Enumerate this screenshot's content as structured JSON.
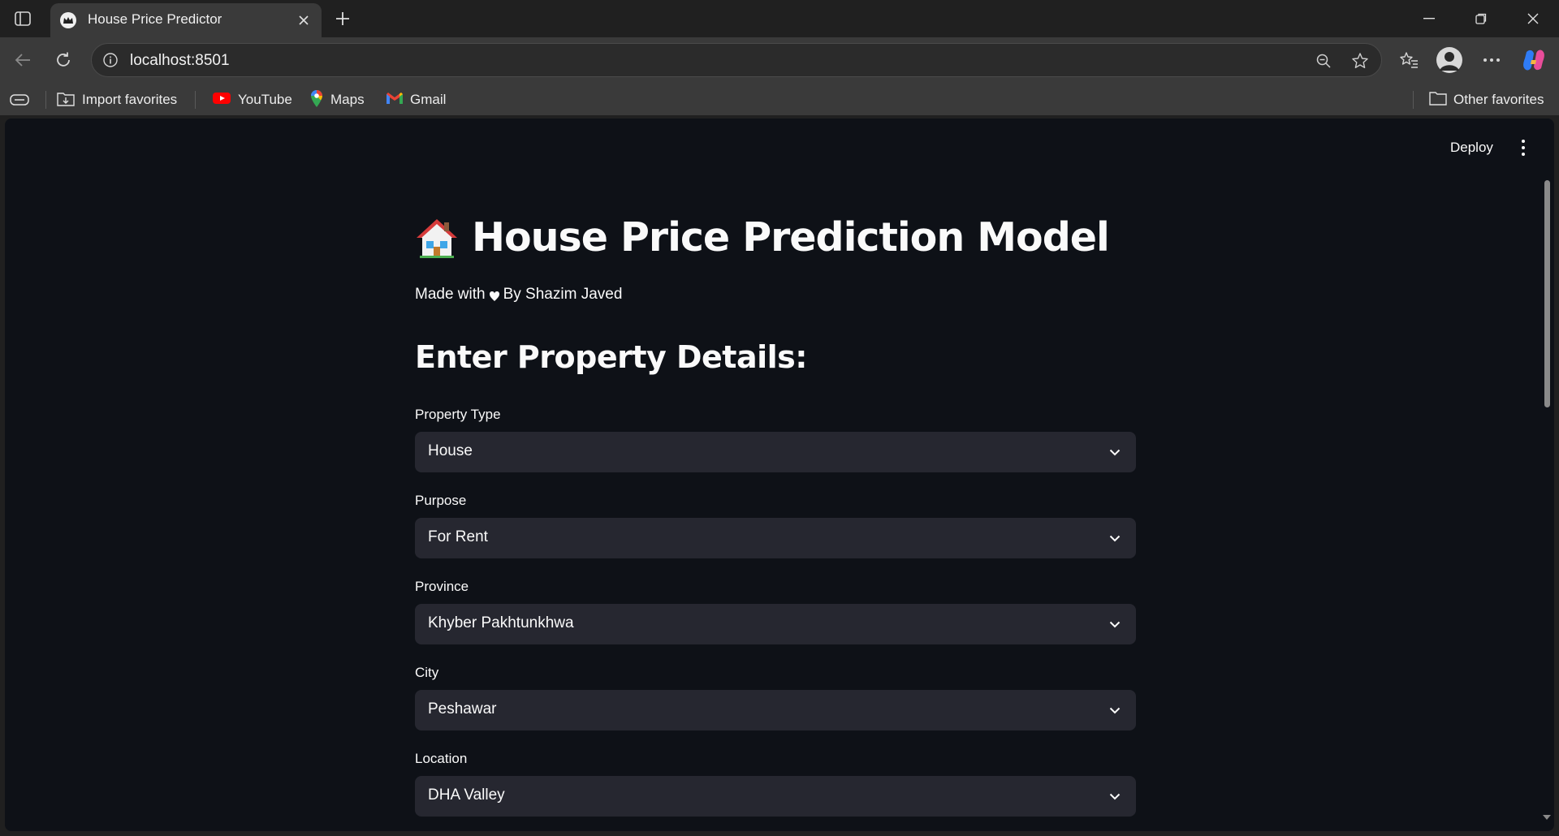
{
  "browser": {
    "tab": {
      "title": "House Price Predictor",
      "favicon": "streamlit-crown-icon"
    },
    "address_bar": {
      "url": "localhost:8501"
    },
    "favorites": [
      {
        "label": "Import favorites",
        "icon": "import-favorites-icon"
      },
      {
        "label": "YouTube",
        "icon": "youtube-icon"
      },
      {
        "label": "Maps",
        "icon": "maps-icon"
      },
      {
        "label": "Gmail",
        "icon": "gmail-icon"
      }
    ],
    "other_favorites": "Other favorites"
  },
  "app": {
    "toolbar": {
      "deploy_label": "Deploy"
    },
    "title": "House Price Prediction Model",
    "credit": {
      "prefix": "Made with",
      "suffix": "By Shazim Javed"
    },
    "section_title": "Enter Property Details:",
    "fields": [
      {
        "label": "Property Type",
        "value": "House"
      },
      {
        "label": "Purpose",
        "value": "For Rent"
      },
      {
        "label": "Province",
        "value": "Khyber Pakhtunkhwa"
      },
      {
        "label": "City",
        "value": "Peshawar"
      },
      {
        "label": "Location",
        "value": "DHA Valley"
      }
    ]
  },
  "colors": {
    "app_background": "#0e1117",
    "select_background": "#262730",
    "text": "#fafafa",
    "browser_chrome": "#3a3a3a"
  }
}
